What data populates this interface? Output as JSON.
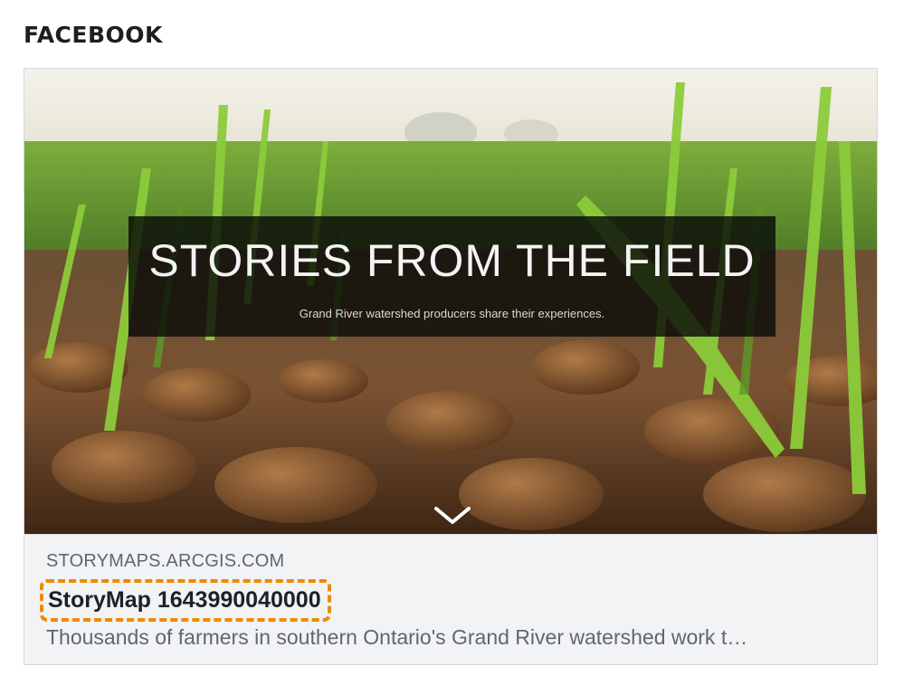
{
  "section": {
    "title": "FACEBOOK"
  },
  "preview": {
    "hero": {
      "title": "STORIES FROM THE FIELD",
      "subtitle": "Grand River watershed producers share their experiences."
    },
    "domain": "STORYMAPS.ARCGIS.COM",
    "headline": "StoryMap 1643990040000",
    "description": "Thousands of farmers in southern Ontario's Grand River watershed work t…"
  },
  "colors": {
    "highlight": "#f28a00",
    "card_bg": "#f2f3f5",
    "domain_text": "#606770",
    "headline_text": "#1d2129"
  },
  "icons": {
    "scroll_down": "chevron-down-icon"
  }
}
